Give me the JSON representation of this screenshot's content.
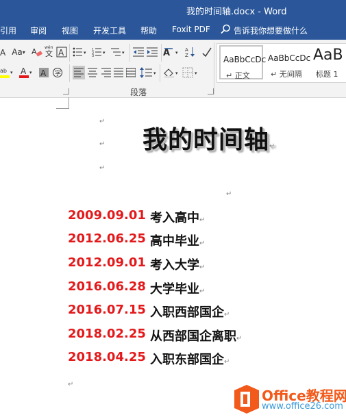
{
  "window": {
    "title": "我的时间轴.docx  -  Word"
  },
  "menu": [
    {
      "label": "引用"
    },
    {
      "label": "审阅"
    },
    {
      "label": "视图"
    },
    {
      "label": "开发工具"
    },
    {
      "label": "帮助"
    },
    {
      "label": "Foxit PDF"
    },
    {
      "label": "告诉我你想要做什么"
    }
  ],
  "ribbon": {
    "font_size_label": "Aa",
    "paragraph_group_label": "段落",
    "styles": [
      {
        "sample": "AaBbCcDc",
        "name": "↵ 正文",
        "selected": true
      },
      {
        "sample": "AaBbCcDc",
        "name": "↵ 无间隔",
        "selected": false
      },
      {
        "sample": "AaB",
        "name": "标题 1",
        "selected": false
      }
    ],
    "colors": {
      "highlight": "#ffff00",
      "font_color": "#e3191b",
      "accent": "#2b579a"
    }
  },
  "document": {
    "heading": "我的时间轴",
    "entries": [
      {
        "date": "2009.09.01",
        "event": "考入高中"
      },
      {
        "date": "2012.06.25",
        "event": "高中毕业"
      },
      {
        "date": "2012.09.01",
        "event": "考入大学"
      },
      {
        "date": "2016.06.28",
        "event": "大学毕业"
      },
      {
        "date": "2016.07.15",
        "event": "入职西部国企"
      },
      {
        "date": "2018.02.25",
        "event": "从西部国企离职"
      },
      {
        "date": "2018.04.25",
        "event": "入职东部国企"
      }
    ],
    "date_color": "#e3191b"
  },
  "watermark": {
    "line1": "Office教程网",
    "line2": "www.office26.com"
  }
}
